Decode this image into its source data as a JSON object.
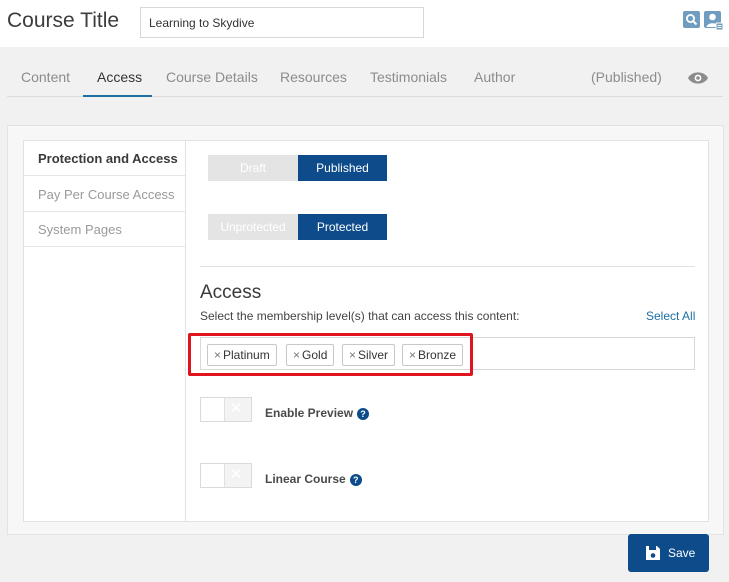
{
  "header": {
    "title": "Course Title",
    "course_name": "Learning to Skydive",
    "icons": [
      "search-icon",
      "user-icon"
    ]
  },
  "tabs": [
    {
      "label": "Content"
    },
    {
      "label": "Access"
    },
    {
      "label": "Course Details"
    },
    {
      "label": "Resources"
    },
    {
      "label": "Testimonials"
    },
    {
      "label": "Author"
    }
  ],
  "status_text": "(Published)",
  "sidebar": {
    "items": [
      {
        "label": "Protection and Access"
      },
      {
        "label": "Pay Per Course Access"
      },
      {
        "label": "System Pages"
      }
    ]
  },
  "publish_toggle": {
    "off": "Draft",
    "on": "Published"
  },
  "protect_toggle": {
    "off": "Unprotected",
    "on": "Protected"
  },
  "access": {
    "heading": "Access",
    "description": "Select the membership level(s) that can access this content:",
    "select_all": "Select All",
    "levels": [
      "Platinum",
      "Gold",
      "Silver",
      "Bronze"
    ]
  },
  "options": {
    "preview_label": "Enable Preview",
    "linear_label": "Linear Course"
  },
  "save_label": "Save",
  "colors": {
    "primary": "#0d4b8b",
    "link": "#1f6fa3",
    "highlight": "#e0141e"
  }
}
